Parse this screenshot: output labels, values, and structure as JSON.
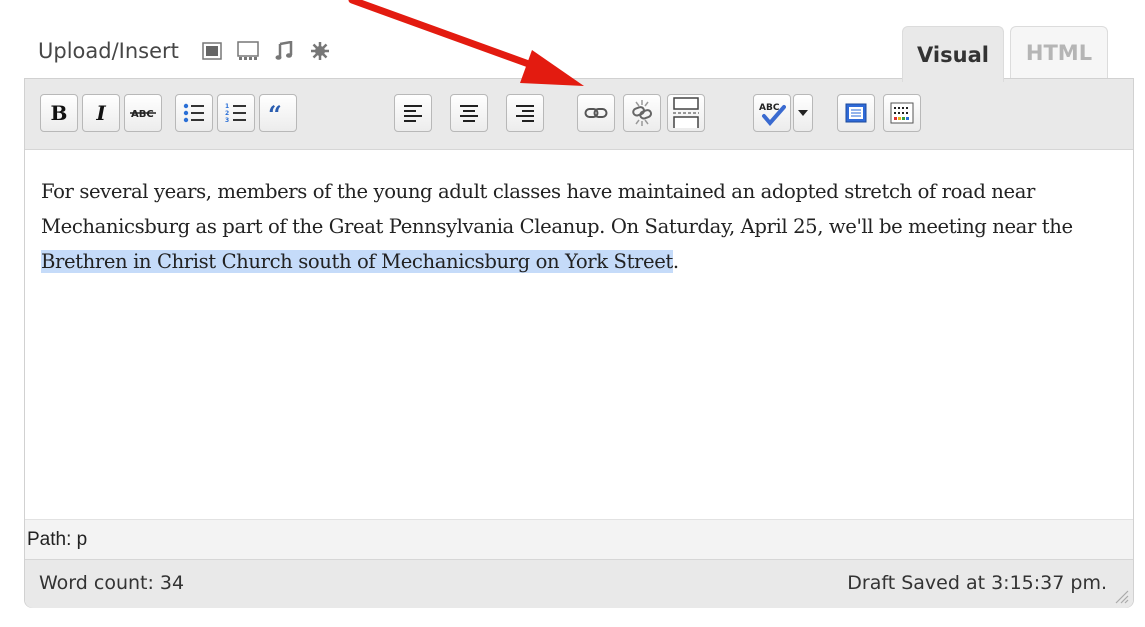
{
  "media": {
    "label": "Upload/Insert",
    "icons": [
      "image-icon",
      "gallery-icon",
      "audio-icon",
      "media-icon"
    ]
  },
  "tabs": {
    "visual": "Visual",
    "html": "HTML",
    "active": "Visual"
  },
  "toolbar": {
    "bold_label": "B",
    "italic_label": "I",
    "buttons": [
      "bold",
      "italic",
      "strikethrough",
      "bullet-list",
      "numbered-list",
      "blockquote",
      "align-left",
      "align-center",
      "align-right",
      "insert-link",
      "unlink",
      "insert-more",
      "spellcheck",
      "fullscreen",
      "kitchen-sink"
    ]
  },
  "content": {
    "before": "For several years, members of the young adult classes have maintained an adopted stretch of road near Mechanicsburg as part of the Great Pennsylvania Cleanup. On Saturday, April 25, we'll be meeting near the ",
    "selected": "Brethren in Christ Church south of Mechanicsburg on York Street",
    "after": "."
  },
  "path": "Path: p",
  "status": {
    "word_count": "Word count: 34",
    "draft": "Draft Saved at 3:15:37 pm."
  },
  "colors": {
    "selection": "#c5dbf9",
    "arrow": "#e31b10",
    "toolbar_bg": "#e9e9e9"
  }
}
